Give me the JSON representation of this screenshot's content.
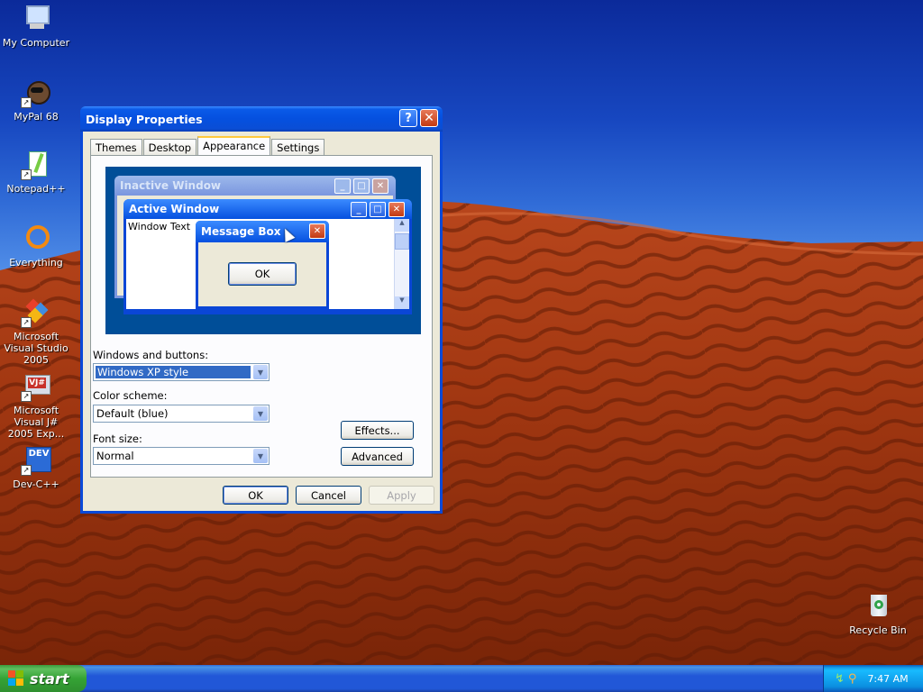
{
  "desktop": {
    "icons": [
      {
        "label": "My Computer"
      },
      {
        "label": "MyPal 68"
      },
      {
        "label": "Notepad++"
      },
      {
        "label": "Everything"
      },
      {
        "label": "Microsoft Visual Studio 2005"
      },
      {
        "label": "Microsoft Visual J# 2005 Exp..."
      },
      {
        "label": "Dev-C++"
      },
      {
        "label": "Recycle Bin"
      }
    ]
  },
  "window": {
    "title": "Display Properties",
    "tabs": [
      {
        "label": "Themes"
      },
      {
        "label": "Desktop"
      },
      {
        "label": "Appearance",
        "active": true
      },
      {
        "label": "Settings"
      }
    ],
    "preview": {
      "inactive_title": "Inactive Window",
      "active_title": "Active Window",
      "window_text": "Window Text",
      "message_title": "Message Box",
      "ok_label": "OK"
    },
    "windows_buttons": {
      "label": "Windows and buttons:",
      "value": "Windows XP style"
    },
    "color_scheme": {
      "label": "Color scheme:",
      "value": "Default (blue)"
    },
    "font_size": {
      "label": "Font size:",
      "value": "Normal"
    },
    "effects_label": "Effects...",
    "advanced_label": "Advanced",
    "ok_label": "OK",
    "cancel_label": "Cancel",
    "apply_label": "Apply"
  },
  "taskbar": {
    "start_label": "start",
    "clock": "7:47 AM"
  },
  "colors": {
    "titlebar": "#0550df",
    "dialog_bg": "#ece9d8",
    "selection": "#316ac5",
    "start_green": "#35a335"
  }
}
